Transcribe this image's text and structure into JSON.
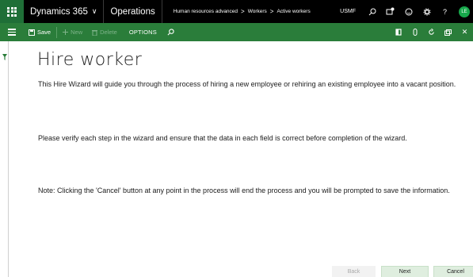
{
  "topbar": {
    "app_name": "Dynamics 365",
    "app_chevron": "∨",
    "module": "Operations",
    "breadcrumb": [
      "Human resources advanced",
      "Workers",
      "Active workers"
    ],
    "breadcrumb_sep": ">",
    "company": "USMF",
    "icons": [
      "waffle-icon",
      "search-icon",
      "notifications-icon",
      "feedback-smiley-icon",
      "settings-gear-icon",
      "help-icon"
    ],
    "help_label": "?",
    "notification_count": "0",
    "user_initials": "LE"
  },
  "actionpane": {
    "save_label": "Save",
    "new_label": "New",
    "delete_label": "Delete",
    "options_label": "OPTIONS",
    "right_icons": [
      "office-icon",
      "attach-icon",
      "refresh-icon",
      "popout-icon",
      "close-icon"
    ],
    "close_glyph": "✕"
  },
  "page": {
    "title": "Hire worker",
    "paragraphs": [
      "This Hire Wizard will guide you through the process of hiring a new employee or rehiring an existing employee into a vacant position.",
      "Please verify each step in the wizard and ensure that the data in each field is correct before completion of the wizard.",
      "Note: Clicking the 'Cancel' button at any point in the process will end the process and you will be prompted to save the information."
    ]
  },
  "footer": {
    "back_label": "Back",
    "next_label": "Next",
    "cancel_label": "Cancel"
  },
  "colors": {
    "topbar_bg": "#000000",
    "actionpane_bg": "#2a7d3a",
    "accent": "#17a84b",
    "button_bg": "#dfeedf"
  }
}
